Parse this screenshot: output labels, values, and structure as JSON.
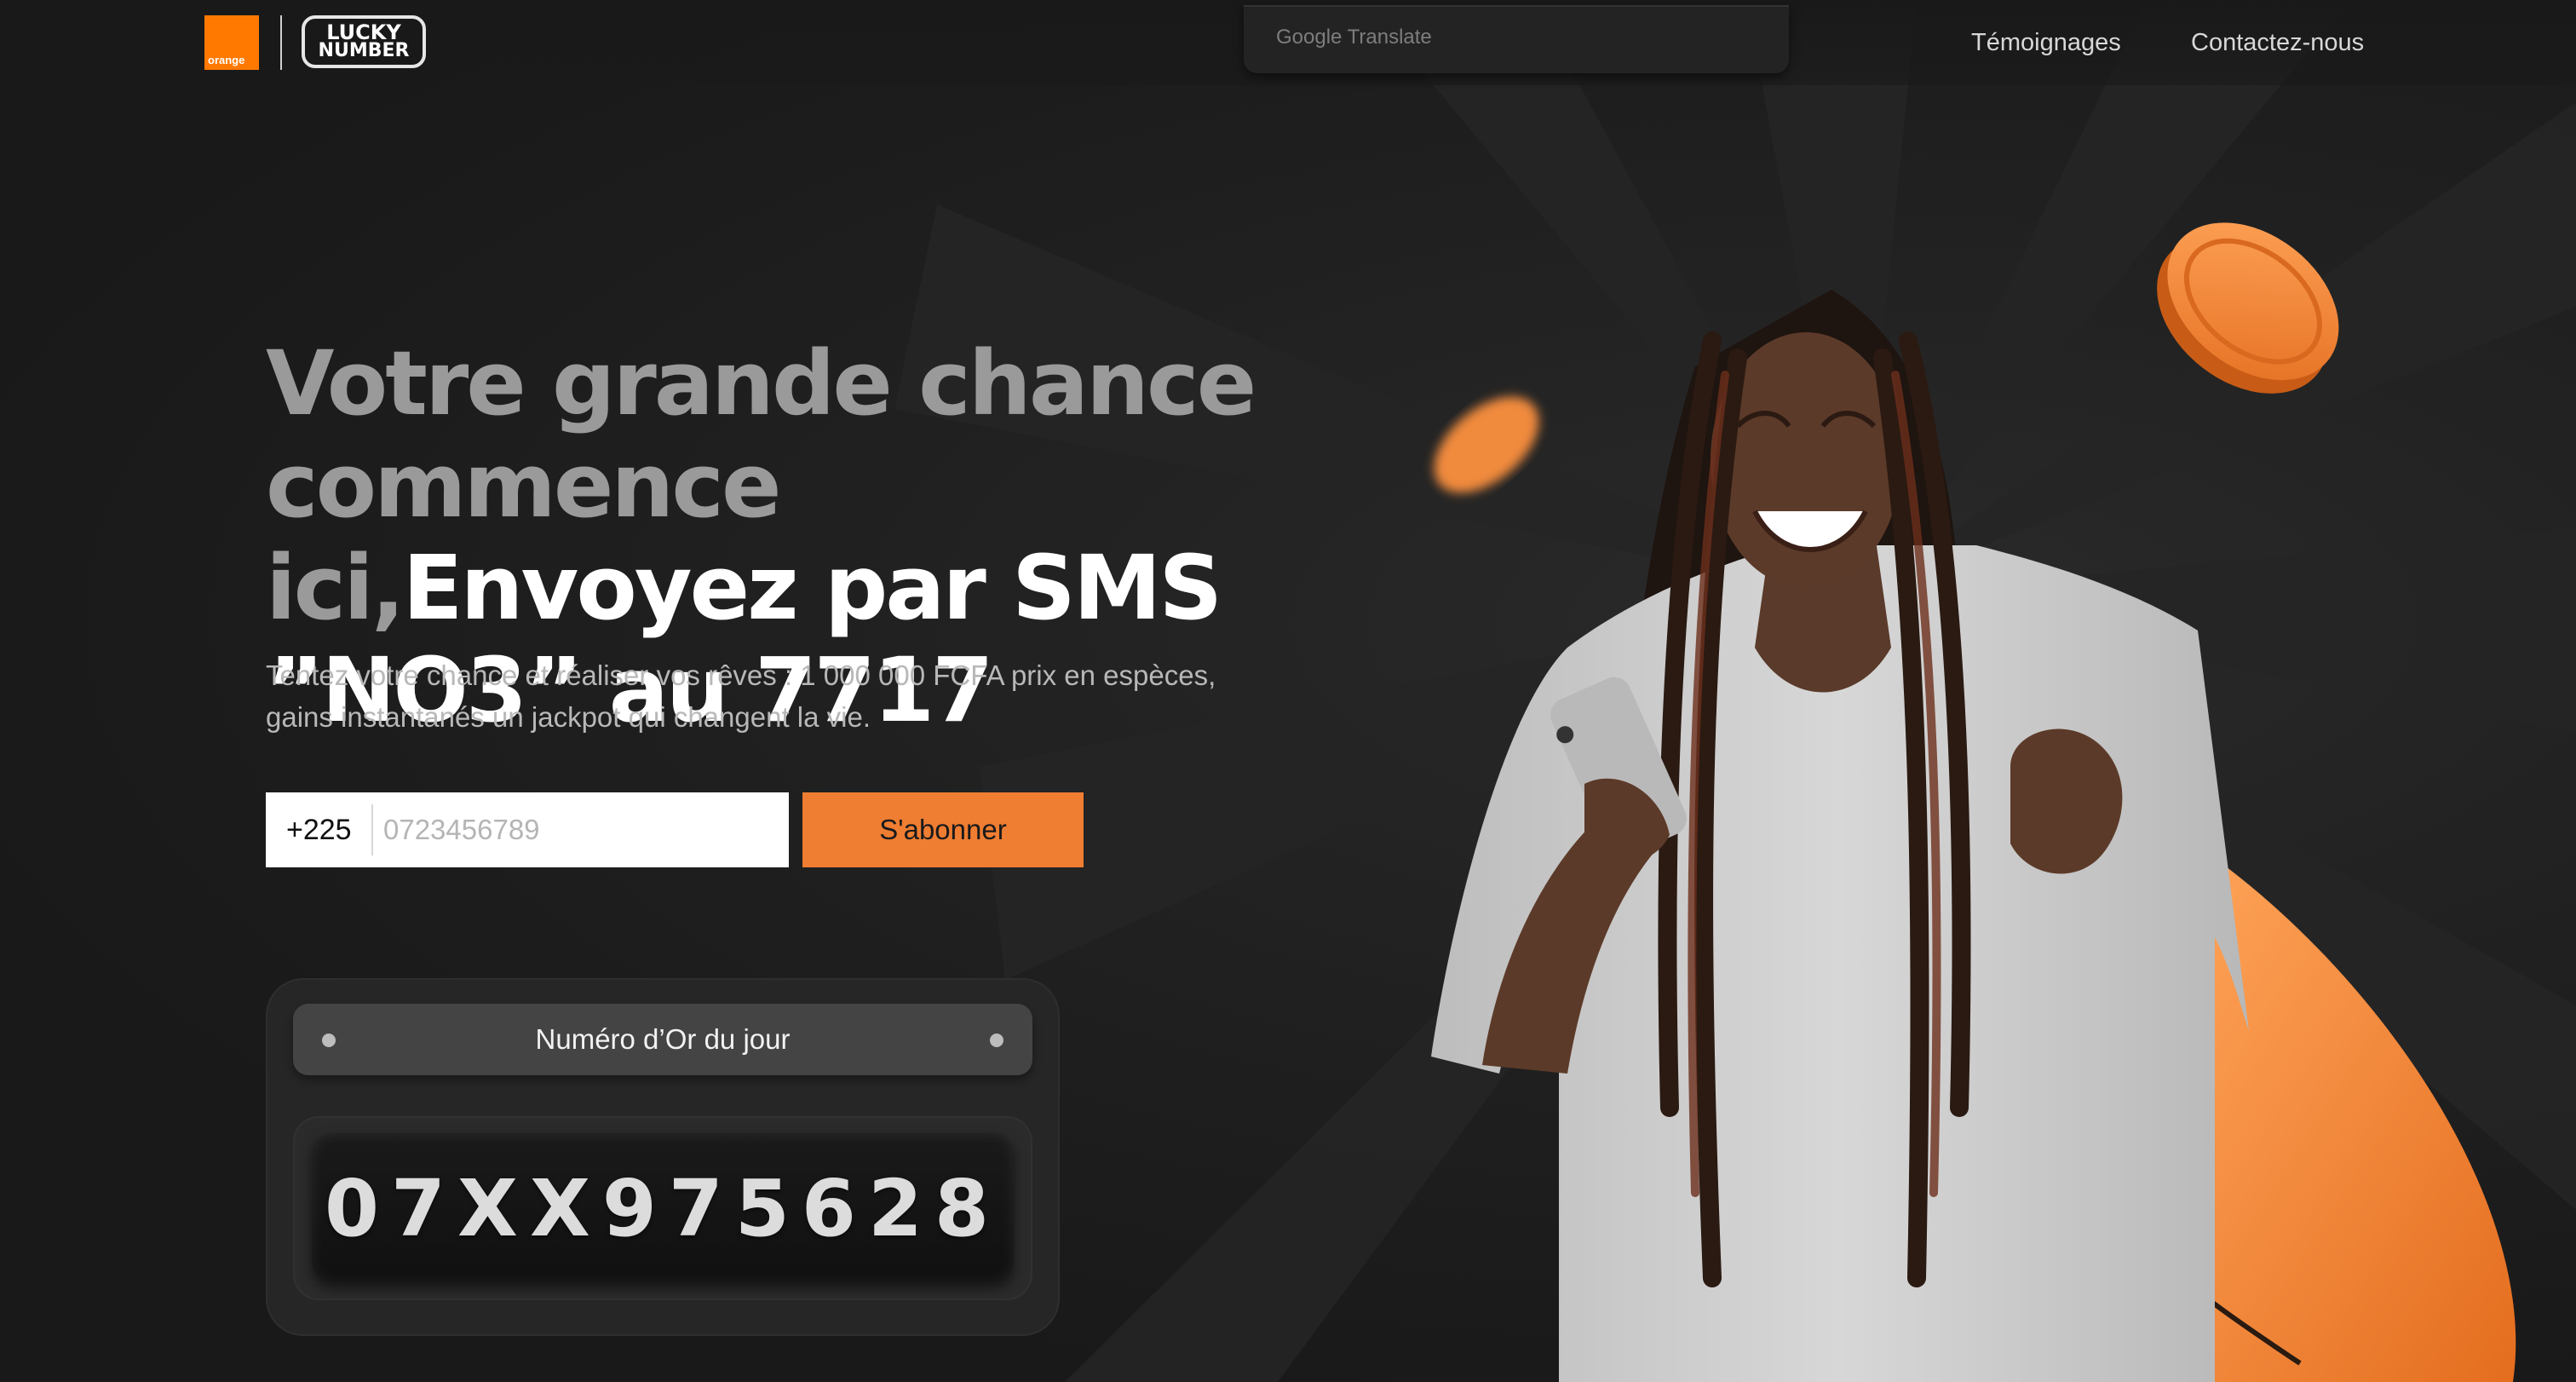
{
  "header": {
    "orange_logo_text": "orange",
    "lucky_logo_line1": "LUCKY",
    "lucky_logo_line2": "NUMBER",
    "translate_label": "Google Translate",
    "nav": [
      {
        "label": "Témoignages"
      },
      {
        "label": "Contactez-nous"
      }
    ]
  },
  "hero": {
    "headline_grey": "Votre grande chance commence ici,",
    "headline_white": "Envoyez par SMS ”NO3” au 7717",
    "subtitle": "Tentez votre chance et réaliser vos rêves : 1 000 000 FCFA prix en espèces, gains instantanés un jackpot qui changent la vie."
  },
  "form": {
    "country_code": "+225",
    "phone_placeholder": "0723456789",
    "phone_value": "",
    "subscribe_label": "S'abonner"
  },
  "golden_number": {
    "label": "Numéro d’Or du jour",
    "value": "07XX975628"
  },
  "colors": {
    "accent_orange": "#ef7d32",
    "brand_orange": "#ff7900",
    "background": "#1b1b1b"
  }
}
